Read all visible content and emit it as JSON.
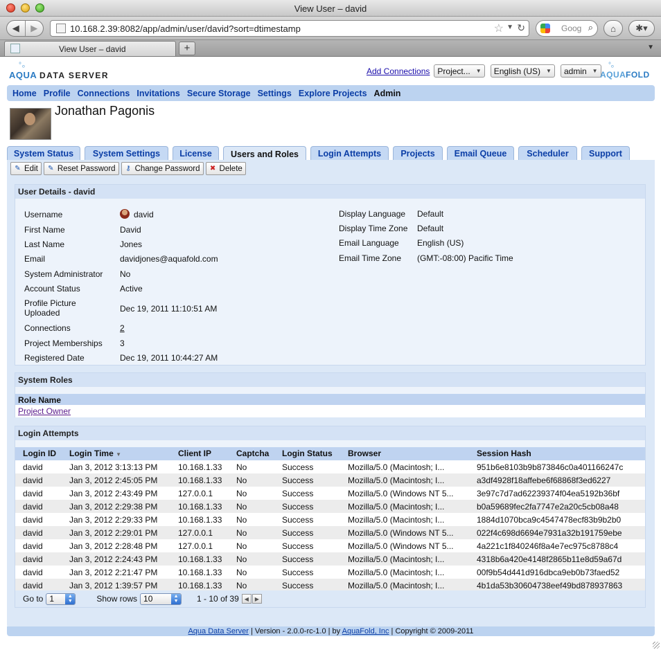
{
  "window": {
    "title": "View User – david"
  },
  "browser": {
    "url": "10.168.2.39:8082/app/admin/user/david?sort=dtimestamp",
    "search_placeholder": "Goog",
    "tab_title": "View User – david",
    "new_tab_label": "+"
  },
  "header": {
    "logo_left_aqua": "AQUA",
    "logo_left_server": "DATA SERVER",
    "add_connections": "Add Connections",
    "project_select": "Project...",
    "language_select": "English (US)",
    "user_select": "admin",
    "logo_right_aqua": "AQUA",
    "logo_right_fold": "FOLD"
  },
  "main_nav": [
    "Home",
    "Profile",
    "Connections",
    "Invitations",
    "Secure Storage",
    "Settings",
    "Explore Projects",
    "Admin"
  ],
  "user_display_name": "Jonathan Pagonis",
  "admin_tabs": [
    "System Status",
    "System Settings",
    "License",
    "Users and Roles",
    "Login Attempts",
    "Projects",
    "Email Queue",
    "Scheduler",
    "Support"
  ],
  "toolbar": {
    "edit": "Edit",
    "reset_password": "Reset Password",
    "change_password": "Change Password",
    "delete": "Delete"
  },
  "user_details": {
    "title": "User Details - david",
    "left": [
      {
        "label": "Username",
        "value": "david"
      },
      {
        "label": "First Name",
        "value": "David"
      },
      {
        "label": "Last Name",
        "value": "Jones"
      },
      {
        "label": "Email",
        "value": "davidjones@aquafold.com"
      },
      {
        "label": "System Administrator",
        "value": "No"
      },
      {
        "label": "Account Status",
        "value": "Active"
      },
      {
        "label": "Profile Picture Uploaded",
        "value": "Dec 19, 2011 11:10:51 AM"
      },
      {
        "label": "Connections",
        "value": "2"
      },
      {
        "label": "Project Memberships",
        "value": "3"
      },
      {
        "label": "Registered Date",
        "value": "Dec 19, 2011 10:44:27 AM"
      }
    ],
    "right": [
      {
        "label": "Display Language",
        "value": "Default"
      },
      {
        "label": "Display Time Zone",
        "value": "Default"
      },
      {
        "label": "Email Language",
        "value": "English (US)"
      },
      {
        "label": "Email Time Zone",
        "value": "(GMT:-08:00) Pacific Time"
      }
    ]
  },
  "system_roles": {
    "title": "System Roles",
    "column": "Role Name",
    "roles": [
      "Project Owner"
    ]
  },
  "login_attempts": {
    "title": "Login Attempts",
    "columns": [
      "Login ID",
      "Login Time",
      "Client IP",
      "Captcha",
      "Login Status",
      "Browser",
      "Session Hash"
    ],
    "rows": [
      [
        "david",
        "Jan 3, 2012 3:13:13 PM",
        "10.168.1.33",
        "No",
        "Success",
        "Mozilla/5.0 (Macintosh; I...",
        "951b6e8103b9b873846c0a401166247c"
      ],
      [
        "david",
        "Jan 3, 2012 2:45:05 PM",
        "10.168.1.33",
        "No",
        "Success",
        "Mozilla/5.0 (Macintosh; I...",
        "a3df4928f18affebe6f68868f3ed6227"
      ],
      [
        "david",
        "Jan 3, 2012 2:43:49 PM",
        "127.0.0.1",
        "No",
        "Success",
        "Mozilla/5.0 (Windows NT 5...",
        "3e97c7d7ad62239374f04ea5192b36bf"
      ],
      [
        "david",
        "Jan 3, 2012 2:29:38 PM",
        "10.168.1.33",
        "No",
        "Success",
        "Mozilla/5.0 (Macintosh; I...",
        "b0a59689fec2fa7747e2a20c5cb08a48"
      ],
      [
        "david",
        "Jan 3, 2012 2:29:33 PM",
        "10.168.1.33",
        "No",
        "Success",
        "Mozilla/5.0 (Macintosh; I...",
        "1884d1070bca9c4547478ecf83b9b2b0"
      ],
      [
        "david",
        "Jan 3, 2012 2:29:01 PM",
        "127.0.0.1",
        "No",
        "Success",
        "Mozilla/5.0 (Windows NT 5...",
        "022f4c698d6694e7931a32b191759ebe"
      ],
      [
        "david",
        "Jan 3, 2012 2:28:48 PM",
        "127.0.0.1",
        "No",
        "Success",
        "Mozilla/5.0 (Windows NT 5...",
        "4a221c1f840246f8a4e7ec975c8788c4"
      ],
      [
        "david",
        "Jan 3, 2012 2:24:43 PM",
        "10.168.1.33",
        "No",
        "Success",
        "Mozilla/5.0 (Macintosh; I...",
        "4318b6a420e4148f2865b11e8d59a67d"
      ],
      [
        "david",
        "Jan 3, 2012 2:21:47 PM",
        "10.168.1.33",
        "No",
        "Success",
        "Mozilla/5.0 (Macintosh; I...",
        "00f9b54d441d916dbca9eb0b73faed52"
      ],
      [
        "david",
        "Jan 3, 2012 1:39:57 PM",
        "10.168.1.33",
        "No",
        "Success",
        "Mozilla/5.0 (Macintosh; I...",
        "4b1da53b30604738eef49bd878937863"
      ]
    ],
    "pager": {
      "goto_label": "Go to",
      "goto_value": "1",
      "show_rows_label": "Show rows",
      "show_rows_value": "10",
      "range": "1 - 10 of 39"
    }
  },
  "footer": {
    "product": "Aqua Data Server",
    "version": " | Version - 2.0.0-rc-1.0 | by ",
    "company": "AquaFold, Inc",
    "copyright": " | Copyright © 2009-2011"
  }
}
